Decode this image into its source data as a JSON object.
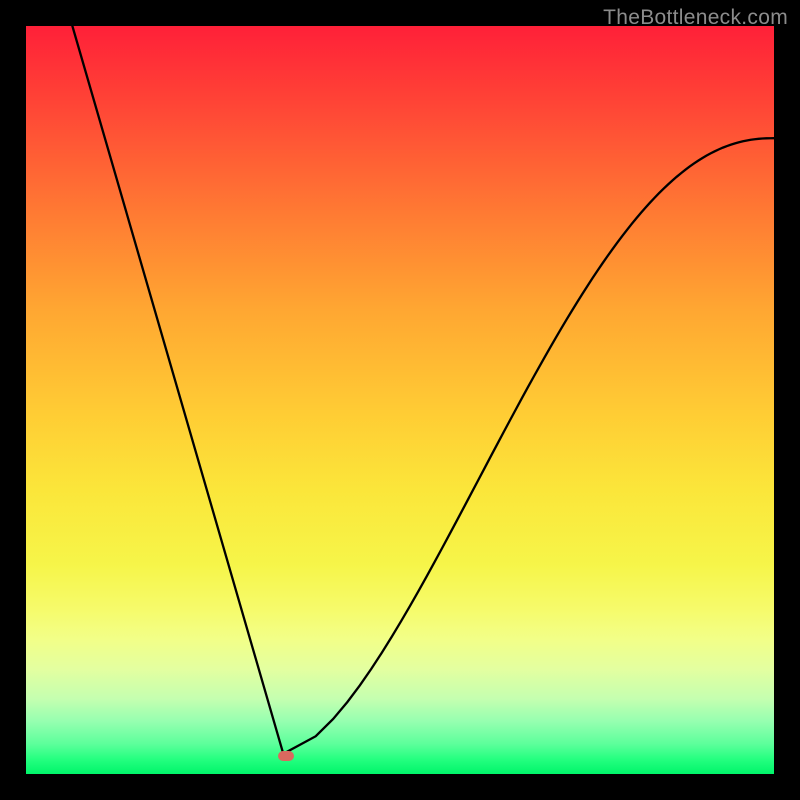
{
  "watermark": "TheBottleneck.com",
  "chart_data": {
    "type": "line",
    "title": "",
    "xlabel": "",
    "ylabel": "",
    "xlim": [
      0,
      1
    ],
    "ylim": [
      0,
      1
    ],
    "note": "Axes are unlabelled in the source image; coordinates are normalized fractions of the plotting area (x from left, y from top). The curve is a V-shape with a cusp minimum.",
    "curve_points": [
      {
        "x": 0.062,
        "y": 0.0
      },
      {
        "x": 0.344,
        "y": 0.973,
        "role": "cusp"
      },
      {
        "x": 0.5,
        "y": 0.78
      },
      {
        "x": 0.7,
        "y": 0.48
      },
      {
        "x": 0.85,
        "y": 0.29
      },
      {
        "x": 1.0,
        "y": 0.15
      }
    ],
    "marker": {
      "x": 0.347,
      "y": 0.976,
      "color": "#d9695f"
    },
    "background_gradient": [
      "#ff2038",
      "#ffcd34",
      "#f6f549",
      "#00f56a"
    ]
  }
}
